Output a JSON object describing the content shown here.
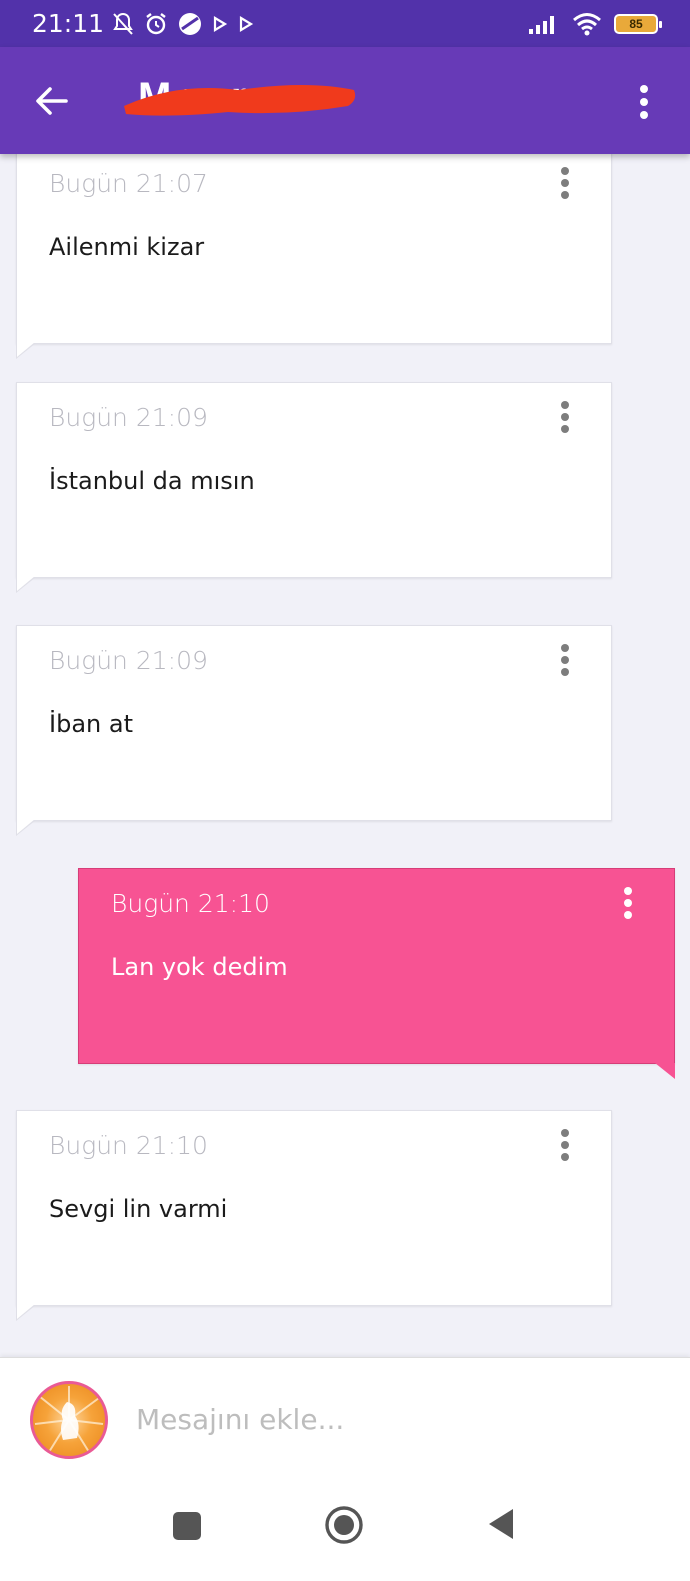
{
  "status_bar": {
    "time": "21:11",
    "battery": "85"
  },
  "header": {
    "title": "M      ver"
  },
  "messages": [
    {
      "time": "Bugün 21:07",
      "text": "Ailenmi kizar",
      "direction": "in"
    },
    {
      "time": "Bugün 21:09",
      "text": "İstanbul da mısın",
      "direction": "in"
    },
    {
      "time": "Bugün 21:09",
      "text": "İban at",
      "direction": "in"
    },
    {
      "time": "Bugün 21:10",
      "text": "Lan yok dedim",
      "direction": "out"
    },
    {
      "time": "Bugün 21:10",
      "text": "Sevgi lin varmi",
      "direction": "in"
    }
  ],
  "composer": {
    "placeholder": "Mesajını ekle..."
  },
  "colors": {
    "status_bar": "#5232aa",
    "app_bar": "#673ab7",
    "outgoing_bubble": "#f75393",
    "background": "#f1f1f8",
    "redaction": "#f03a1c"
  },
  "icons": {
    "back": "arrow-left-icon",
    "menu": "more-vert-icon",
    "nav_recent": "square-icon",
    "nav_home": "circle-icon",
    "nav_back": "triangle-back-icon"
  }
}
